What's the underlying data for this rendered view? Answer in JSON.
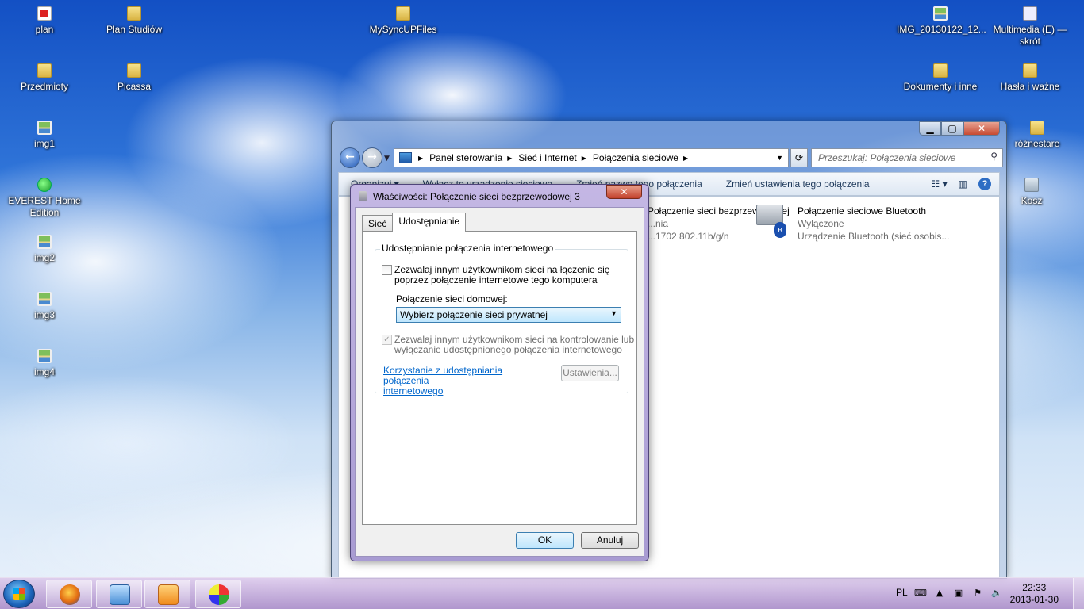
{
  "desktop": {
    "icons": [
      {
        "label": "plan",
        "icon": "pdf-icon",
        "kind": "pdf"
      },
      {
        "label": "Plan Studiów",
        "icon": "folder-icon",
        "kind": "folder"
      },
      {
        "label": "MySyncUPFiles",
        "icon": "folder-icon",
        "kind": "folder"
      },
      {
        "label": "IMG_20130122_12...",
        "icon": "image-icon",
        "kind": "pic"
      },
      {
        "label": "Multimedia (E) — skrót",
        "icon": "shortcut-icon",
        "kind": "shortcut"
      },
      {
        "label": "Przedmioty",
        "icon": "folder-icon",
        "kind": "folder"
      },
      {
        "label": "Picassa",
        "icon": "folder-icon",
        "kind": "folder"
      },
      {
        "label": "Dokumenty i inne",
        "icon": "folder-icon",
        "kind": "folder"
      },
      {
        "label": "Hasła i ważne",
        "icon": "folder-icon",
        "kind": "folder"
      },
      {
        "label": "img1",
        "icon": "image-icon",
        "kind": "pic"
      },
      {
        "label": "różnestare",
        "icon": "folder-icon",
        "kind": "folder"
      },
      {
        "label": "EVEREST Home Edition",
        "icon": "app-icon",
        "kind": "app"
      },
      {
        "label": "Kosz",
        "icon": "recycle-bin-icon",
        "kind": "bin"
      },
      {
        "label": "img2",
        "icon": "image-icon",
        "kind": "pic"
      },
      {
        "label": "img3",
        "icon": "image-icon",
        "kind": "pic"
      },
      {
        "label": "img4",
        "icon": "image-icon",
        "kind": "pic"
      }
    ]
  },
  "explorer": {
    "caption": {
      "minimize": "▁",
      "maximize": "▢",
      "close": "✕"
    },
    "breadcrumbs": [
      "Panel sterowania",
      "Sieć i Internet",
      "Połączenia sieciowe"
    ],
    "search_placeholder": "Przeszukaj: Połączenia sieciowe",
    "commands": [
      "Organizuj ▾",
      "Wyłącz to urządzenie sieciowe",
      "Zmień nazwę tego połączenia",
      "Zmień ustawienia tego połączenia"
    ],
    "connections": [
      {
        "title": "Połączenie sieci bezprzewodowej",
        "status": "...nia",
        "device": "...1702 802.11b/g/n"
      },
      {
        "title": "Połączenie sieciowe Bluetooth",
        "status": "Wyłączone",
        "device": "Urządzenie Bluetooth (sieć osobis..."
      }
    ]
  },
  "dialog": {
    "title": "Właściwości: Połączenie sieci bezprzewodowej 3",
    "close": "✕",
    "tabs": [
      "Sieć",
      "Udostępnianie"
    ],
    "active_tab": "Udostępnianie",
    "group_title": "Udostępnianie połączenia internetowego",
    "allow_share_line1": "Zezwalaj innym użytkownikom sieci na łączenie się",
    "allow_share_line2": "poprzez połączenie internetowe tego komputera",
    "allow_share_checked": false,
    "home_network_label": "Połączenie sieci domowej:",
    "home_network_value": "Wybierz połączenie sieci prywatnej",
    "allow_control_line1": "Zezwalaj innym użytkownikom sieci na kontrolowanie lub",
    "allow_control_line2": "wyłączanie udostępnionego połączenia internetowego",
    "allow_control_checked": true,
    "link_line1": "Korzystanie z udostępniania połączenia",
    "link_line2": "internetowego",
    "settings_button": "Ustawienia...",
    "ok_button": "OK",
    "cancel_button": "Anuluj"
  },
  "taskbar": {
    "language": "PL",
    "time": "22:33",
    "date": "2013-01-30",
    "pinned": [
      {
        "name": "firefox",
        "icon": "firefox-icon"
      },
      {
        "name": "control-panel",
        "icon": "control-panel-icon"
      },
      {
        "name": "media-player",
        "icon": "media-player-icon"
      },
      {
        "name": "paint",
        "icon": "paint-icon"
      }
    ]
  }
}
